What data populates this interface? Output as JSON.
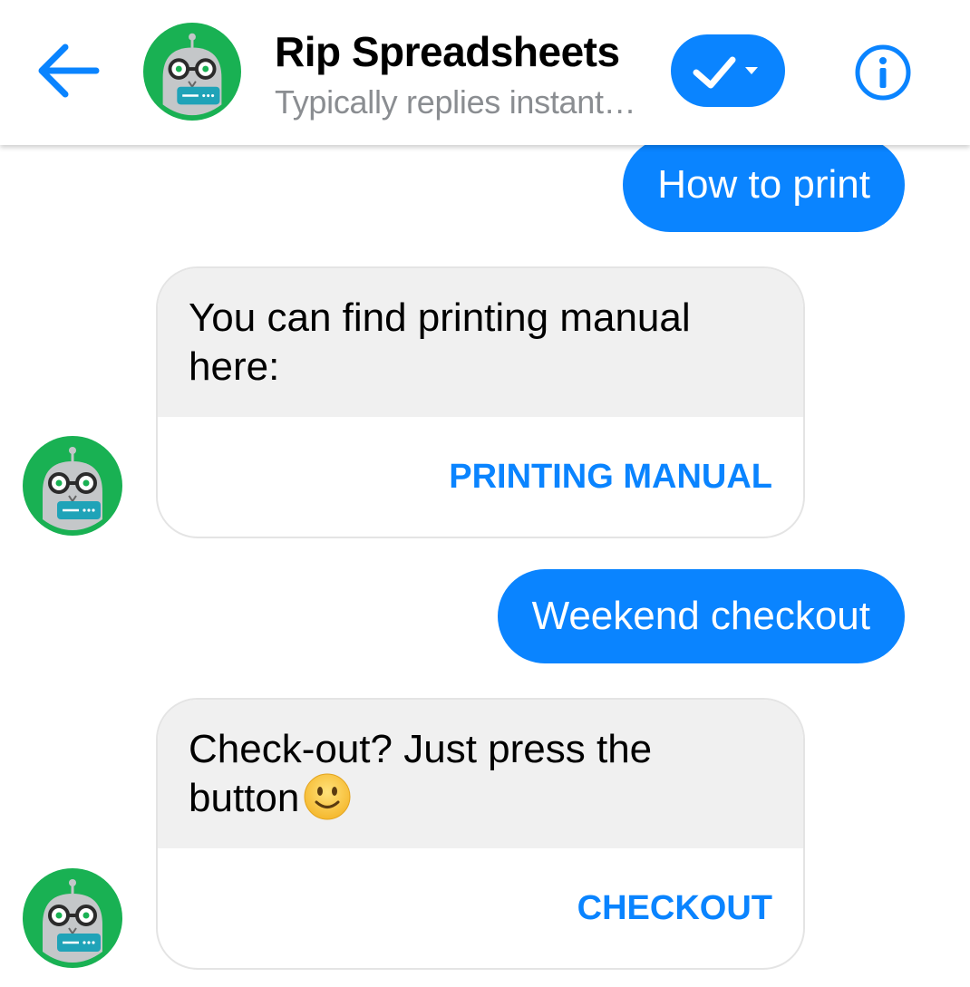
{
  "header": {
    "title": "Rip Spreadsheets",
    "subtitle": "Typically replies instant…",
    "back_icon": "arrow-left-icon",
    "done_icon": "check-dropdown-icon",
    "info_icon": "info-icon"
  },
  "messages": [
    {
      "from": "user",
      "text": "How to print"
    },
    {
      "from": "bot",
      "text": "You can find printing manual here:",
      "action": "PRINTING MANUAL"
    },
    {
      "from": "user",
      "text": "Weekend checkout"
    },
    {
      "from": "bot",
      "text": "Check-out? Just press the button",
      "emoji": "slightly-smiling-face-icon",
      "action": "CHECKOUT"
    }
  ],
  "colors": {
    "accent": "#0a84ff",
    "bot_bubble": "#f0f0f0",
    "avatar_green": "#19b153",
    "subtitle": "#8a8d91"
  }
}
